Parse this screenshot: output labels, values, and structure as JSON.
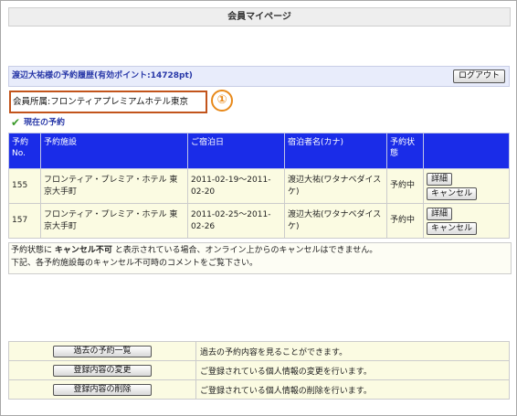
{
  "page": {
    "title": "会員マイページ"
  },
  "member": {
    "history_title": "渡辺大祐様の予約履歴(有効ポイント:14728pt)",
    "logout_label": "ログアウト",
    "affiliation": "会員所属:フロンティアプレミアムホテル東京",
    "callout_number": "①"
  },
  "current": {
    "section_label": "現在の予約",
    "headers": [
      "予約No.",
      "予約施設",
      "ご宿泊日",
      "宿泊者名(カナ)",
      "予約状態",
      ""
    ],
    "rows": [
      {
        "no": "155",
        "facility": "フロンティア・プレミア・ホテル 東京大手町",
        "dates": "2011-02-19～2011-02-20",
        "guest": "渡辺大祐(ワタナベダイスケ)",
        "status": "予約中",
        "detail_label": "詳細",
        "cancel_label": "キャンセル"
      },
      {
        "no": "157",
        "facility": "フロンティア・プレミア・ホテル 東京大手町",
        "dates": "2011-02-25～2011-02-26",
        "guest": "渡辺大祐(ワタナベダイスケ)",
        "status": "予約中",
        "detail_label": "詳細",
        "cancel_label": "キャンセル"
      }
    ],
    "note_line1_before": "予約状態に ",
    "note_line1_bold": "キャンセル不可",
    "note_line1_after": " と表示されている場合、オンライン上からのキャンセルはできません。",
    "note_line2": "下記、各予約施設毎のキャンセル不可時のコメントをご覧下さい。"
  },
  "menu": [
    {
      "button": "過去の予約一覧",
      "description": "過去の予約内容を見ることができます。"
    },
    {
      "button": "登録内容の変更",
      "description": "ご登録されている個人情報の変更を行います。"
    },
    {
      "button": "登録内容の削除",
      "description": "ご登録されている個人情報の削除を行います。"
    }
  ]
}
